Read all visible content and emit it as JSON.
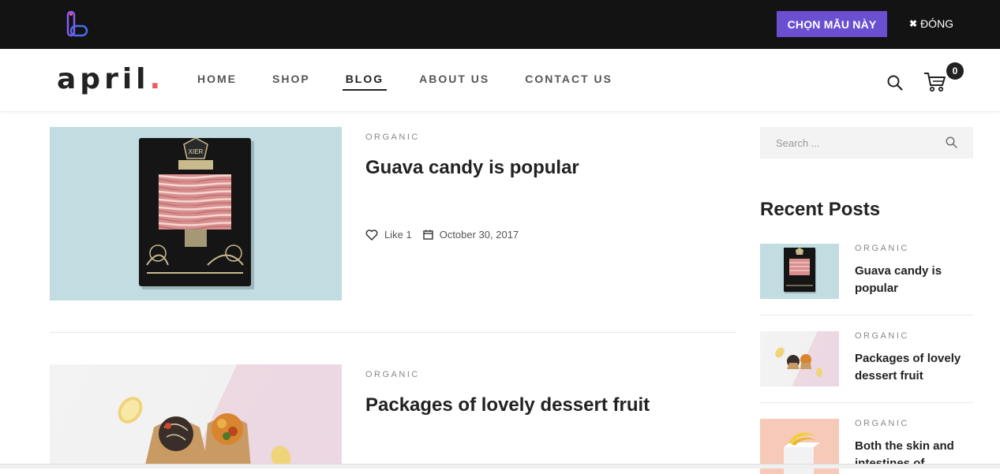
{
  "topbar": {
    "choose_label": "CHỌN MẪU NÀY",
    "close_label": "ĐÓNG"
  },
  "header": {
    "brand": "april",
    "brand_dot": ".",
    "nav": [
      {
        "label": "HOME"
      },
      {
        "label": "SHOP"
      },
      {
        "label": "BLOG",
        "active": true
      },
      {
        "label": "ABOUT US"
      },
      {
        "label": "CONTACT US"
      }
    ],
    "cart_count": "0"
  },
  "posts": [
    {
      "category": "ORGANIC",
      "title": "Guava candy is popular",
      "like_label": "Like 1",
      "date": "October 30, 2017"
    },
    {
      "category": "ORGANIC",
      "title": "Packages of lovely dessert fruit"
    }
  ],
  "sidebar": {
    "search_placeholder": "Search ...",
    "recent_heading": "Recent Posts",
    "recent_posts": [
      {
        "category": "ORGANIC",
        "title": "Guava candy is popular"
      },
      {
        "category": "ORGANIC",
        "title": "Packages of lovely dessert fruit"
      },
      {
        "category": "ORGANIC",
        "title": "Both the skin and intestines of"
      }
    ]
  },
  "colors": {
    "accent_purple": "#6a4fd1",
    "brand_dot": "#ef5a5a",
    "topbar_bg": "#131313"
  }
}
